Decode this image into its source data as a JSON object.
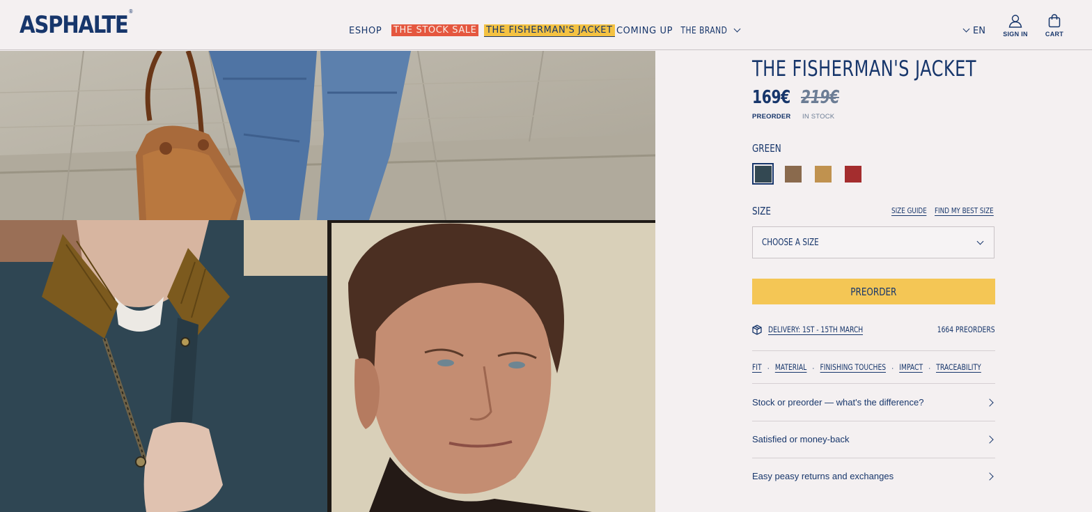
{
  "brand": {
    "logo": "ASPHALTE",
    "registered": "®"
  },
  "nav": {
    "items": [
      {
        "label": "ESHOP"
      },
      {
        "label": "THE STOCK SALE"
      },
      {
        "label": "THE FISHERMAN'S JACKET"
      },
      {
        "label": "COMING UP"
      },
      {
        "label": "THE BRAND"
      }
    ]
  },
  "header": {
    "lang": "EN",
    "signin": "SIGN IN",
    "cart": "CART"
  },
  "product": {
    "title": "THE FISHERMAN'S JACKET",
    "price": "169€",
    "price_label": "PREORDER",
    "old_price": "219€",
    "old_price_label": "IN STOCK",
    "color_name": "GREEN",
    "swatches": [
      {
        "name": "green",
        "color": "#334852"
      },
      {
        "name": "brown",
        "color": "#8a6a4d"
      },
      {
        "name": "camel",
        "color": "#c0924f"
      },
      {
        "name": "red",
        "color": "#a42d2e"
      }
    ],
    "size_label": "SIZE",
    "size_guide": "SIZE GUIDE",
    "find_size": "FIND MY BEST SIZE",
    "size_placeholder": "CHOOSE A SIZE",
    "cta": "PREORDER",
    "delivery": "DELIVERY: 1ST - 15TH MARCH",
    "preorders": "1664 PREORDERS",
    "tabs": [
      "FIT",
      "MATERIAL",
      "FINISHING TOUCHES",
      "IMPACT",
      "TRACEABILITY"
    ],
    "accordion": [
      "Stock or preorder — what's the difference?",
      "Satisfied or money-back",
      "Easy peasy returns and exchanges"
    ]
  },
  "colors": {
    "accent_sale": "#e5573f",
    "accent_yellow": "#f4c655",
    "navy": "#17366b"
  }
}
